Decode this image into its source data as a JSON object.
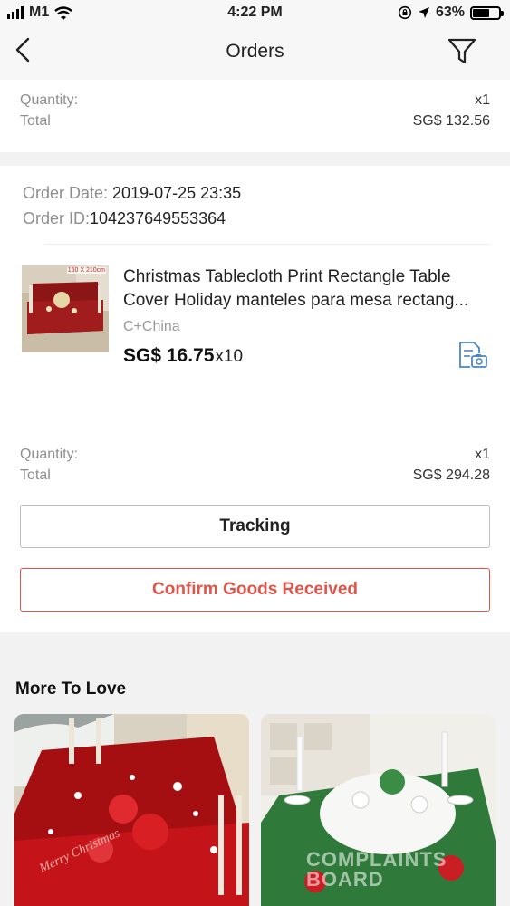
{
  "status_bar": {
    "carrier": "M1",
    "time": "4:22 PM",
    "battery": "63%",
    "battery_level": 0.63
  },
  "nav": {
    "title": "Orders"
  },
  "previous_order": {
    "quantity_label": "Quantity:",
    "quantity_value": "x1",
    "total_label": "Total",
    "total_value": "SG$ 132.56"
  },
  "order": {
    "date_label": "Order Date: ",
    "date_value": "2019-07-25 23:35",
    "id_label": "Order ID:",
    "id_value": "104237649553364",
    "product": {
      "thumb_caption": "150 X 210cm",
      "name": "Christmas Tablecloth Print Rectangle Table Cover Holiday manteles para mesa rectang...",
      "seller": "C+China",
      "price": "SG$ 16.75",
      "quantity": "x10"
    },
    "quantity_label": "Quantity:",
    "quantity_value": "x1",
    "total_label": "Total",
    "total_value": "SG$ 294.28",
    "tracking_button": "Tracking",
    "confirm_button": "Confirm Goods Received"
  },
  "more_to_love": {
    "title": "More To Love",
    "watermark": "COMPLAINTS BOARD"
  },
  "colors": {
    "accent": "#e0554a",
    "icon_blue": "#4a86c8",
    "background": "#f2f2f2"
  }
}
